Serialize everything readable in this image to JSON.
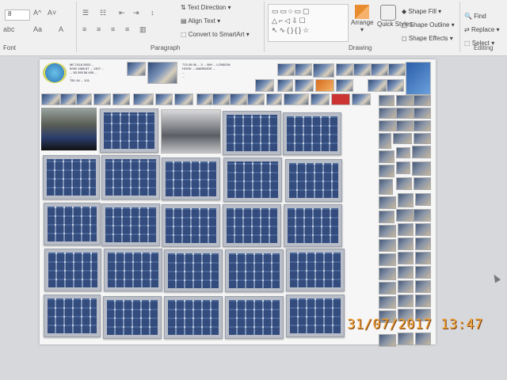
{
  "ribbon": {
    "font_size": "8",
    "text_direction": "Text Direction",
    "align_text": "Align Text",
    "convert_smartart": "Convert to SmartArt",
    "arrange": "Arrange",
    "quick_styles": "Quick Styles",
    "shape_fill": "Shape Fill",
    "shape_outline": "Shape Outline",
    "shape_effects": "Shape Effects",
    "find": "Find",
    "replace": "Replace",
    "select": "Select",
    "groups": {
      "font": "Font",
      "paragraph": "Paragraph",
      "drawing": "Drawing",
      "editing": "Editing"
    }
  },
  "slide": {
    "contact_left": [
      "MC 0118 2653 ...",
      "0090 1366 87 ... 1307 ...",
      "... 50 395 56 495 ...",
      "...",
      "TEL 94 ... 101"
    ],
    "contact_right": [
      "713 45 06 ... 3 ... NW ... LONDON",
      "HOOK ... MARBODE ...",
      "... ",
      "..."
    ],
    "link_text": "... "
  },
  "timestamp": "31/07/2017  13:47"
}
